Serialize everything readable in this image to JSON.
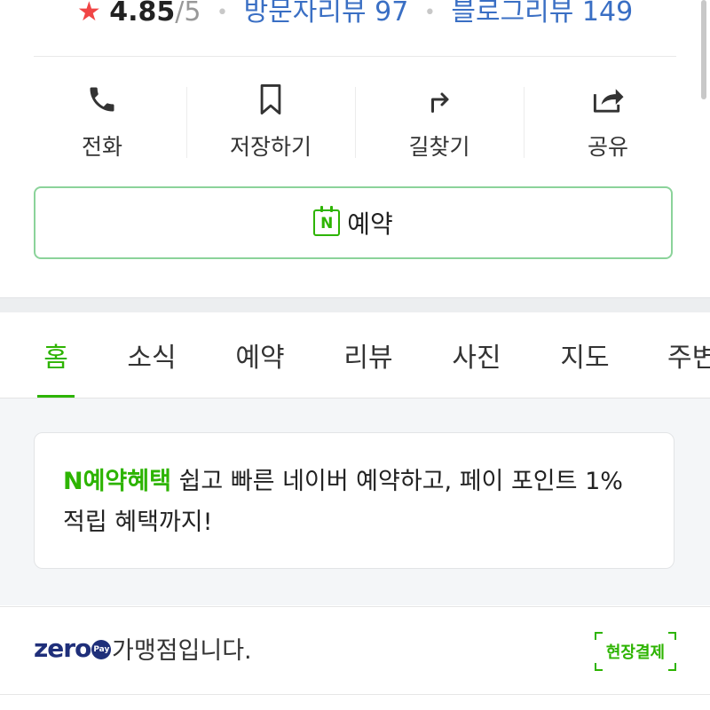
{
  "summary": {
    "star_icon": "star-icon",
    "score": "4.85",
    "out_of": "/5",
    "visitor_reviews": "방문자리뷰 97",
    "blog_reviews": "블로그리뷰 149"
  },
  "actions": [
    {
      "label": "전화",
      "icon": "phone-icon"
    },
    {
      "label": "저장하기",
      "icon": "bookmark-icon"
    },
    {
      "label": "길찾기",
      "icon": "directions-icon"
    },
    {
      "label": "공유",
      "icon": "share-icon"
    }
  ],
  "reserve": {
    "badge": "N",
    "label": "예약"
  },
  "tabs": [
    {
      "label": "홈",
      "active": true
    },
    {
      "label": "소식"
    },
    {
      "label": "예약"
    },
    {
      "label": "리뷰"
    },
    {
      "label": "사진"
    },
    {
      "label": "지도"
    },
    {
      "label": "주변"
    }
  ],
  "promo": {
    "highlight": "N예약혜택",
    "text": " 쉽고 빠른 네이버 예약하고, 페이 포인트 1% 적립 혜택까지!"
  },
  "payment": {
    "zero_logo_text": "zero",
    "pay_badge": "Pay",
    "merchant_text": "가맹점입니다.",
    "onsite_label": "현장결제"
  },
  "colors": {
    "accent": "#2db400",
    "star": "#f04545",
    "link": "#3a6fc4",
    "zero": "#1f2f7a"
  }
}
